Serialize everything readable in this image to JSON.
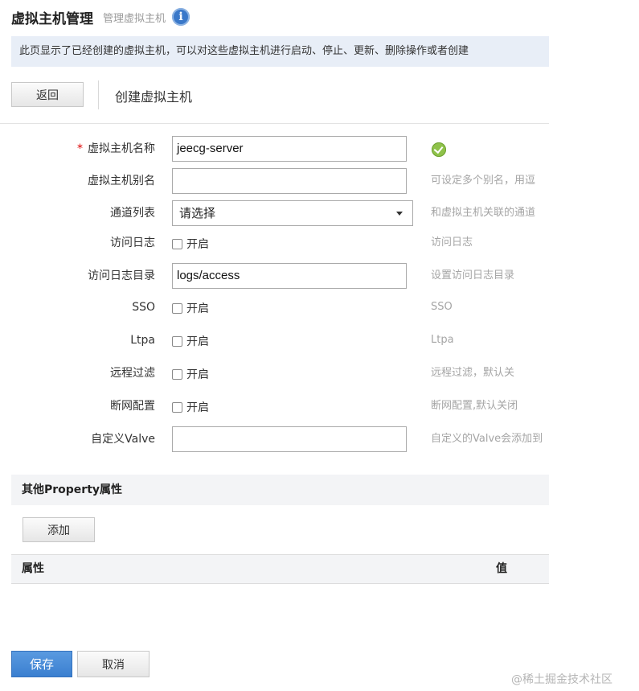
{
  "header": {
    "title": "虚拟主机管理",
    "subtitle": "管理虚拟主机",
    "info_icon": "i"
  },
  "notice": "此页显示了已经创建的虚拟主机，可以对这些虚拟主机进行启动、停止、更新、删除操作或者创建",
  "toolbar": {
    "back_label": "返回",
    "title": "创建虚拟主机"
  },
  "form": {
    "name": {
      "required_mark": "*",
      "label": "虚拟主机名称",
      "value": "jeecg-server",
      "status_icon": "check-circle-icon"
    },
    "alias": {
      "label": "虚拟主机别名",
      "value": "",
      "hint": "可设定多个别名，用逗"
    },
    "channel": {
      "label": "通道列表",
      "selected": "请选择",
      "hint": "和虚拟主机关联的通道"
    },
    "access_log": {
      "label": "访问日志",
      "option": "开启",
      "checked": false,
      "hint": "访问日志"
    },
    "access_log_dir": {
      "label": "访问日志目录",
      "value": "logs/access",
      "hint": "设置访问日志目录"
    },
    "sso": {
      "label": "SSO",
      "option": "开启",
      "checked": false,
      "hint": "SSO"
    },
    "ltpa": {
      "label": "Ltpa",
      "option": "开启",
      "checked": false,
      "hint": "Ltpa"
    },
    "remote_filter": {
      "label": "远程过滤",
      "option": "开启",
      "checked": false,
      "hint": "远程过滤，默认关"
    },
    "disconnect": {
      "label": "断网配置",
      "option": "开启",
      "checked": false,
      "hint": "断网配置,默认关闭"
    },
    "valve": {
      "label": "自定义Valve",
      "value": "",
      "hint": "自定义的Valve会添加到"
    }
  },
  "properties": {
    "section_title": "其他Property属性",
    "add_label": "添加",
    "columns": [
      "属性",
      "值"
    ]
  },
  "footer": {
    "save_label": "保存",
    "cancel_label": "取消"
  },
  "watermark": "@稀土掘金技术社区",
  "colors": {
    "accent": "#3a7fd0",
    "notice_bg": "#e8eef7",
    "success": "#8fc24a",
    "required": "#dd0000"
  }
}
